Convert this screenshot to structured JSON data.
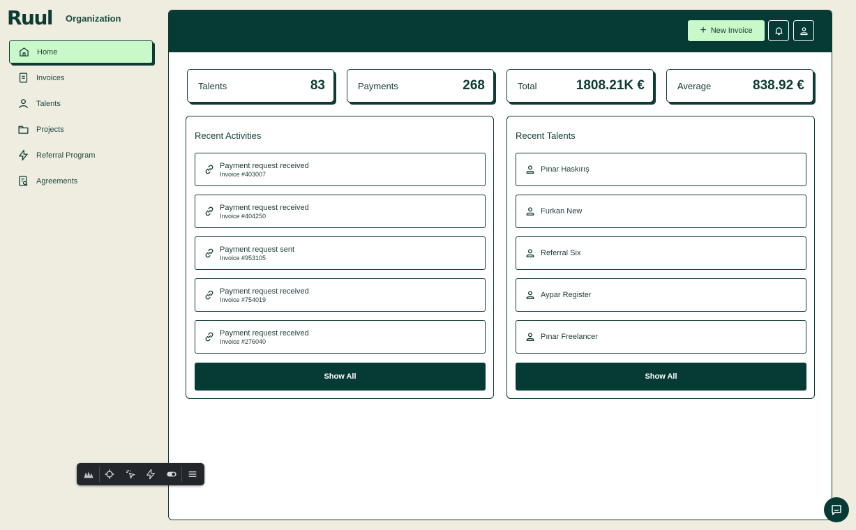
{
  "brand": {
    "logo": "Ruul",
    "org_label": "Organization"
  },
  "sidebar": {
    "items": [
      {
        "label": "Home",
        "icon": "home-icon",
        "active": true
      },
      {
        "label": "Invoices",
        "icon": "invoice-icon"
      },
      {
        "label": "Talents",
        "icon": "user-icon"
      },
      {
        "label": "Projects",
        "icon": "folder-icon"
      },
      {
        "label": "Referral Program",
        "icon": "lightning-icon"
      },
      {
        "label": "Agreements",
        "icon": "agreement-icon"
      }
    ]
  },
  "header": {
    "new_invoice_label": "New Invoice"
  },
  "stats": [
    {
      "label": "Talents",
      "value": "83"
    },
    {
      "label": "Payments",
      "value": "268"
    },
    {
      "label": "Total",
      "value": "1808.21K €"
    },
    {
      "label": "Average",
      "value": "838.92 €"
    }
  ],
  "recent_activities": {
    "title": "Recent Activities",
    "items": [
      {
        "title": "Payment request received",
        "subtitle": "Invoice #403007"
      },
      {
        "title": "Payment request received",
        "subtitle": "Invoice #404250"
      },
      {
        "title": "Payment request sent",
        "subtitle": "Invoice #953105"
      },
      {
        "title": "Payment request received",
        "subtitle": "Invoice #754019"
      },
      {
        "title": "Payment request received",
        "subtitle": "Invoice #276040"
      }
    ],
    "show_all_label": "Show All"
  },
  "recent_talents": {
    "title": "Recent Talents",
    "items": [
      {
        "name": "Pınar Haskırış"
      },
      {
        "name": "Furkan New"
      },
      {
        "name": "Referral Six"
      },
      {
        "name": "Aypar Register"
      },
      {
        "name": "Pınar Freelancer"
      }
    ],
    "show_all_label": "Show All"
  },
  "colors": {
    "primary": "#053b34",
    "accent": "#c9f9c8",
    "background": "#efece0"
  }
}
